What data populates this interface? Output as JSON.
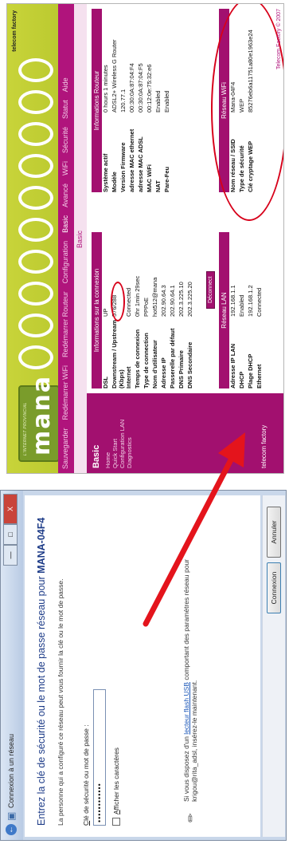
{
  "router": {
    "brand_tag": "L'INTERNET PROVINCIAL",
    "logo": "mana",
    "brand_corner": "telecom factory",
    "nav": [
      "Sauvegarder",
      "Redémarrer WiFi",
      "Redémarrer Routeur",
      "Configuration",
      "Basic",
      "Avancé",
      "WiFi",
      "Sécurité",
      "Statut",
      "Aide"
    ],
    "nav_active": "Basic",
    "subheader": "Basic",
    "sidebar": {
      "title": "Basic",
      "items": [
        "Home",
        "Quick Start",
        "Configuration LAN",
        "Diagnostics"
      ],
      "footer_logo": "telecom factory"
    },
    "connexion": {
      "header": "Informations sur la connexion",
      "rows": [
        {
          "k": "DSL",
          "v": "UP"
        },
        {
          "k": "Downstream / Upstream (Kbps)",
          "v": "576/288"
        },
        {
          "k": "Internet",
          "v": "Connected"
        },
        {
          "k": "Temps de connexion",
          "v": "0hr 1min 29sec"
        },
        {
          "k": "Type de connection",
          "v": "PPPoE"
        },
        {
          "k": "Nom d'utilisateur",
          "v": "hot512@mana"
        },
        {
          "k": "Adresse IP",
          "v": "202.90.64.3"
        },
        {
          "k": "Passerelle par défaut",
          "v": "202.90.64.1"
        },
        {
          "k": "DNS Primaire",
          "v": "202.3.225.10"
        },
        {
          "k": "DNS Secondaire",
          "v": "202.3.225.20"
        }
      ],
      "disconnect_button": "Déconnect"
    },
    "lan": {
      "header": "Réseau LAN",
      "rows": [
        {
          "k": "Adresse IP LAN",
          "v": "192.168.1.1"
        },
        {
          "k": "DHCP",
          "v": "Enabled"
        },
        {
          "k": "Plage DHCP",
          "v": "192.168.1.2"
        },
        {
          "k": "Ethernet",
          "v": "Connected"
        }
      ]
    },
    "routeur": {
      "header": "Informations Routeur",
      "rows": [
        {
          "k": "Système actif",
          "v": "0 hours 1 minutes"
        },
        {
          "k": "Modèle",
          "v": "ADSL2+ Wireless G Router"
        },
        {
          "k": "Version Firmware",
          "v": "120.77.1"
        },
        {
          "k": "adresse MAC ethernet",
          "v": "00:30:0A:87:04:F4"
        },
        {
          "k": "adresse MAC ADSL",
          "v": "00:30:0A:87:04:F5"
        },
        {
          "k": "MAC WiFi",
          "v": "00:12:0e:75:32:e6"
        },
        {
          "k": "NAT",
          "v": "Enabled"
        },
        {
          "k": "Pare-Feu",
          "v": "Enabled"
        }
      ]
    },
    "wifi": {
      "header": "Réseau WiFi",
      "rows": [
        {
          "k": "Nom réseau / SSID",
          "v": "Mana-04F4"
        },
        {
          "k": "Type de sécurité",
          "v": "WEP"
        },
        {
          "k": "Clé cryptage WEP",
          "v": "85276eb6a11751a80e1963e24"
        }
      ]
    },
    "footer": "Telecom Factory © 2007"
  },
  "dialog": {
    "window_title": "Connexion à un réseau",
    "minimize": "—",
    "maximize": "□",
    "close": "X",
    "heading_prefix": "Entrez la clé de sécurité ou le mot de passe réseau pour ",
    "heading_network": "MANA-04F4",
    "description": "La personne qui a configuré ce réseau peut vous fournir la clé ou le mot de passe.",
    "password_label_accel": "C",
    "password_label_rest": "lé de sécurité ou mot de passe :",
    "password_value": "••••••••••••",
    "show_chars_accel": "A",
    "show_chars_rest": "fficher les caractères",
    "usb_text_before": "Si vous disposez d'un ",
    "usb_link": "lecteur flash USB",
    "usb_text_after": " comportant des paramètres réseau pour krigou@rita_adsl, insérez-le maintenant.",
    "connect_button": "Connexion",
    "cancel_button": "Annuler"
  },
  "colors": {
    "router_magenta": "#a2106f",
    "router_lime": "#c0cd34",
    "annotation_red": "#d7001a",
    "windows_blue": "#1e3c88"
  }
}
